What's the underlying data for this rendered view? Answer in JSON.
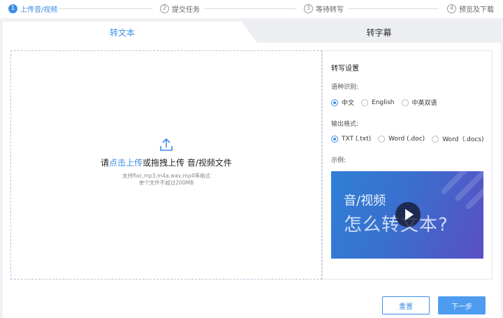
{
  "steps": [
    {
      "num": "1",
      "label": "上传音/视频"
    },
    {
      "num": "2",
      "label": "提交任务"
    },
    {
      "num": "3",
      "label": "等待转写"
    },
    {
      "num": "4",
      "label": "预览及下载"
    }
  ],
  "tabs": {
    "text": "转文本",
    "subtitle": "转字幕"
  },
  "upload": {
    "prefix": "请",
    "link": "点击上传",
    "suffix": "或拖拽上传 音/视频文件",
    "hint_formats": "支持flac,mp3,m4a,wav,mp4等格式",
    "hint_size": "单个文件不超过200MB"
  },
  "settings": {
    "title": "转写设置",
    "language_label": "语种识别:",
    "languages": [
      "中文",
      "English",
      "中英双语"
    ],
    "format_label": "输出格式:",
    "formats": [
      "TXT (.txt)",
      "Word (.doc)",
      "Word（.docs)"
    ],
    "example_label": "示例:",
    "example_line1": "音/视频",
    "example_line2": "怎么转文本?"
  },
  "buttons": {
    "reset": "重置",
    "next": "下一步"
  },
  "colors": {
    "accent": "#3c8ee6"
  }
}
